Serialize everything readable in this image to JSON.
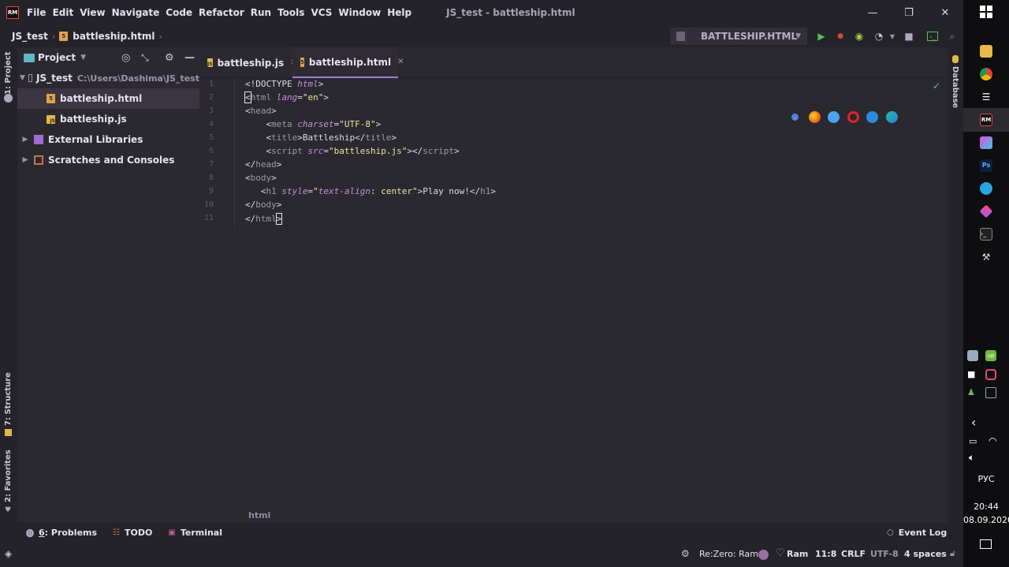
{
  "titlebar": {
    "app_logo": "RM",
    "menu": [
      "File",
      "Edit",
      "View",
      "Navigate",
      "Code",
      "Refactor",
      "Run",
      "Tools",
      "VCS",
      "Window",
      "Help"
    ],
    "window_title": "JS_test - battleship.html",
    "controls": {
      "minimize": "—",
      "restore": "❐",
      "close": "✕"
    }
  },
  "navbar": {
    "breadcrumb": [
      "JS_test",
      "battleship.html"
    ],
    "run_config": "BATTLESHIP.HTML"
  },
  "left_strip": {
    "project": "1: Project",
    "structure": "7: Structure",
    "favorites": "2: Favorites"
  },
  "right_strip": {
    "database": "Database"
  },
  "project_panel": {
    "title": "Project",
    "tree": [
      {
        "label": "JS_test",
        "path": "C:\\Users\\Dashima\\JS_test",
        "level": 0,
        "expanded": true,
        "type": "folder"
      },
      {
        "label": "battleship.html",
        "level": 1,
        "type": "html",
        "selected": true
      },
      {
        "label": "battleship.js",
        "level": 1,
        "type": "js"
      },
      {
        "label": "External Libraries",
        "level": 0,
        "expanded": false,
        "type": "library"
      },
      {
        "label": "Scratches and Consoles",
        "level": 0,
        "expanded": false,
        "type": "scratches"
      }
    ]
  },
  "tabs": [
    {
      "label": "battleship.js",
      "icon": "js-file-icon",
      "active": false
    },
    {
      "label": "battleship.html",
      "icon": "html-file-icon",
      "active": true
    }
  ],
  "editor": {
    "line_numbers": [
      "1",
      "2",
      "3",
      "4",
      "5",
      "6",
      "7",
      "8",
      "9",
      "10",
      "11"
    ],
    "bottom_crumb": "html",
    "browsers": [
      "chrome",
      "firefox",
      "safari",
      "opera",
      "internet-explorer",
      "edge"
    ]
  },
  "bottom_tools": {
    "problems_num": "6",
    "problems": ": Problems",
    "todo": "TODO",
    "terminal": "Terminal",
    "event_log": "Event Log"
  },
  "status": {
    "theme": "Re:Zero: Ram",
    "ram": "Ram",
    "position": "11:8",
    "line_sep": "CRLF",
    "encoding": "UTF-8",
    "indent": "4 spaces"
  },
  "taskbar": {
    "lang": "РУС",
    "time": "20:44",
    "date": "08.09.2020"
  },
  "colors": {
    "accent": "#9b7fd6",
    "background": "#2b2930",
    "panel": "#25232a"
  }
}
